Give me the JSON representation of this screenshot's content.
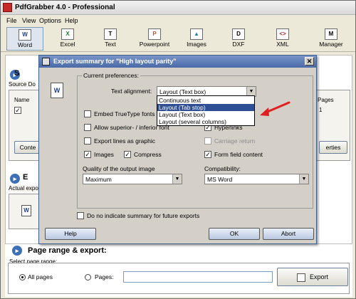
{
  "window": {
    "title": "PdfGrabber 4.0 - Professional"
  },
  "menu": [
    "File",
    "View",
    "Options",
    "Help"
  ],
  "toolbar": [
    {
      "label": "Word",
      "icon": "W"
    },
    {
      "label": "Excel",
      "icon": "X"
    },
    {
      "label": "Text",
      "icon": "T"
    },
    {
      "label": "Powerpoint",
      "icon": "P"
    },
    {
      "label": "Images",
      "icon": "▲"
    },
    {
      "label": "DXF",
      "icon": "D"
    },
    {
      "label": "XML",
      "icon": "<>"
    },
    {
      "label": "Manager",
      "icon": "M"
    }
  ],
  "background": {
    "source_doc_label": "Source Do",
    "name_header": "Name",
    "pages_header": "Pages",
    "pages_value": "1",
    "btn_content": "Conte",
    "btn_properties": "erties",
    "section2_fragment": "E",
    "actual_export_label": "Actual expo",
    "section3_title": "Page range & export:",
    "page_range_label": "Select page range:",
    "all_pages": "All pages",
    "pages": "Pages:",
    "export_btn": "Export"
  },
  "dialog": {
    "title": "Export summary for \"High layout parity\"",
    "group_label": "Current preferences:",
    "text_alignment_label": "Text alignment:",
    "text_alignment_value": "Layout (Text box)",
    "alignment_options": [
      "Continuous text",
      "Layout (Tab stop)",
      "Layout (Text box)",
      "Layout (several columns)"
    ],
    "selected_option_index": 1,
    "embed_fonts": "Embed TrueType fonts",
    "allow_super": "Allow superior- / inferior font",
    "hyperlinks": "Hyperlinks",
    "export_lines": "Export lines as graphic",
    "carriage_return": "Carriage return",
    "images": "Images",
    "compress": "Compress",
    "form_field": "Form field content",
    "quality_label": "Quality of the output image",
    "quality_value": "Maximum",
    "compat_label": "Compatibility:",
    "compat_value": "MS Word",
    "no_indicate": "Do no indicate summary for future exports",
    "help_btn": "Help",
    "ok_btn": "OK",
    "abort_btn": "Abort"
  },
  "colors": {
    "selection": "#2f4f94",
    "arrow": "#e02020"
  }
}
